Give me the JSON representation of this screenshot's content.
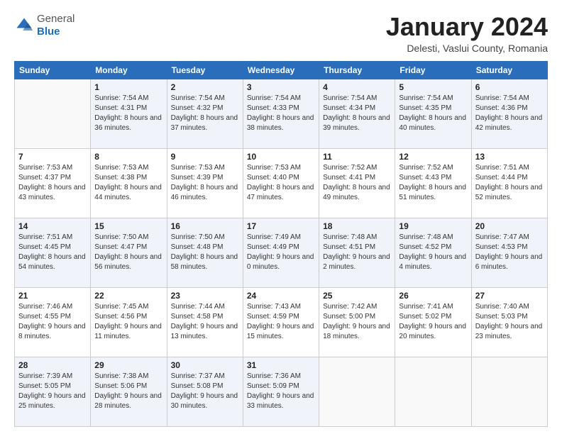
{
  "header": {
    "logo": {
      "general": "General",
      "blue": "Blue"
    },
    "title": "January 2024",
    "location": "Delesti, Vaslui County, Romania"
  },
  "days_of_week": [
    "Sunday",
    "Monday",
    "Tuesday",
    "Wednesday",
    "Thursday",
    "Friday",
    "Saturday"
  ],
  "weeks": [
    [
      {
        "day": "",
        "sunrise": "",
        "sunset": "",
        "daylight": ""
      },
      {
        "day": "1",
        "sunrise": "Sunrise: 7:54 AM",
        "sunset": "Sunset: 4:31 PM",
        "daylight": "Daylight: 8 hours and 36 minutes."
      },
      {
        "day": "2",
        "sunrise": "Sunrise: 7:54 AM",
        "sunset": "Sunset: 4:32 PM",
        "daylight": "Daylight: 8 hours and 37 minutes."
      },
      {
        "day": "3",
        "sunrise": "Sunrise: 7:54 AM",
        "sunset": "Sunset: 4:33 PM",
        "daylight": "Daylight: 8 hours and 38 minutes."
      },
      {
        "day": "4",
        "sunrise": "Sunrise: 7:54 AM",
        "sunset": "Sunset: 4:34 PM",
        "daylight": "Daylight: 8 hours and 39 minutes."
      },
      {
        "day": "5",
        "sunrise": "Sunrise: 7:54 AM",
        "sunset": "Sunset: 4:35 PM",
        "daylight": "Daylight: 8 hours and 40 minutes."
      },
      {
        "day": "6",
        "sunrise": "Sunrise: 7:54 AM",
        "sunset": "Sunset: 4:36 PM",
        "daylight": "Daylight: 8 hours and 42 minutes."
      }
    ],
    [
      {
        "day": "7",
        "sunrise": "Sunrise: 7:53 AM",
        "sunset": "Sunset: 4:37 PM",
        "daylight": "Daylight: 8 hours and 43 minutes."
      },
      {
        "day": "8",
        "sunrise": "Sunrise: 7:53 AM",
        "sunset": "Sunset: 4:38 PM",
        "daylight": "Daylight: 8 hours and 44 minutes."
      },
      {
        "day": "9",
        "sunrise": "Sunrise: 7:53 AM",
        "sunset": "Sunset: 4:39 PM",
        "daylight": "Daylight: 8 hours and 46 minutes."
      },
      {
        "day": "10",
        "sunrise": "Sunrise: 7:53 AM",
        "sunset": "Sunset: 4:40 PM",
        "daylight": "Daylight: 8 hours and 47 minutes."
      },
      {
        "day": "11",
        "sunrise": "Sunrise: 7:52 AM",
        "sunset": "Sunset: 4:41 PM",
        "daylight": "Daylight: 8 hours and 49 minutes."
      },
      {
        "day": "12",
        "sunrise": "Sunrise: 7:52 AM",
        "sunset": "Sunset: 4:43 PM",
        "daylight": "Daylight: 8 hours and 51 minutes."
      },
      {
        "day": "13",
        "sunrise": "Sunrise: 7:51 AM",
        "sunset": "Sunset: 4:44 PM",
        "daylight": "Daylight: 8 hours and 52 minutes."
      }
    ],
    [
      {
        "day": "14",
        "sunrise": "Sunrise: 7:51 AM",
        "sunset": "Sunset: 4:45 PM",
        "daylight": "Daylight: 8 hours and 54 minutes."
      },
      {
        "day": "15",
        "sunrise": "Sunrise: 7:50 AM",
        "sunset": "Sunset: 4:47 PM",
        "daylight": "Daylight: 8 hours and 56 minutes."
      },
      {
        "day": "16",
        "sunrise": "Sunrise: 7:50 AM",
        "sunset": "Sunset: 4:48 PM",
        "daylight": "Daylight: 8 hours and 58 minutes."
      },
      {
        "day": "17",
        "sunrise": "Sunrise: 7:49 AM",
        "sunset": "Sunset: 4:49 PM",
        "daylight": "Daylight: 9 hours and 0 minutes."
      },
      {
        "day": "18",
        "sunrise": "Sunrise: 7:48 AM",
        "sunset": "Sunset: 4:51 PM",
        "daylight": "Daylight: 9 hours and 2 minutes."
      },
      {
        "day": "19",
        "sunrise": "Sunrise: 7:48 AM",
        "sunset": "Sunset: 4:52 PM",
        "daylight": "Daylight: 9 hours and 4 minutes."
      },
      {
        "day": "20",
        "sunrise": "Sunrise: 7:47 AM",
        "sunset": "Sunset: 4:53 PM",
        "daylight": "Daylight: 9 hours and 6 minutes."
      }
    ],
    [
      {
        "day": "21",
        "sunrise": "Sunrise: 7:46 AM",
        "sunset": "Sunset: 4:55 PM",
        "daylight": "Daylight: 9 hours and 8 minutes."
      },
      {
        "day": "22",
        "sunrise": "Sunrise: 7:45 AM",
        "sunset": "Sunset: 4:56 PM",
        "daylight": "Daylight: 9 hours and 11 minutes."
      },
      {
        "day": "23",
        "sunrise": "Sunrise: 7:44 AM",
        "sunset": "Sunset: 4:58 PM",
        "daylight": "Daylight: 9 hours and 13 minutes."
      },
      {
        "day": "24",
        "sunrise": "Sunrise: 7:43 AM",
        "sunset": "Sunset: 4:59 PM",
        "daylight": "Daylight: 9 hours and 15 minutes."
      },
      {
        "day": "25",
        "sunrise": "Sunrise: 7:42 AM",
        "sunset": "Sunset: 5:00 PM",
        "daylight": "Daylight: 9 hours and 18 minutes."
      },
      {
        "day": "26",
        "sunrise": "Sunrise: 7:41 AM",
        "sunset": "Sunset: 5:02 PM",
        "daylight": "Daylight: 9 hours and 20 minutes."
      },
      {
        "day": "27",
        "sunrise": "Sunrise: 7:40 AM",
        "sunset": "Sunset: 5:03 PM",
        "daylight": "Daylight: 9 hours and 23 minutes."
      }
    ],
    [
      {
        "day": "28",
        "sunrise": "Sunrise: 7:39 AM",
        "sunset": "Sunset: 5:05 PM",
        "daylight": "Daylight: 9 hours and 25 minutes."
      },
      {
        "day": "29",
        "sunrise": "Sunrise: 7:38 AM",
        "sunset": "Sunset: 5:06 PM",
        "daylight": "Daylight: 9 hours and 28 minutes."
      },
      {
        "day": "30",
        "sunrise": "Sunrise: 7:37 AM",
        "sunset": "Sunset: 5:08 PM",
        "daylight": "Daylight: 9 hours and 30 minutes."
      },
      {
        "day": "31",
        "sunrise": "Sunrise: 7:36 AM",
        "sunset": "Sunset: 5:09 PM",
        "daylight": "Daylight: 9 hours and 33 minutes."
      },
      {
        "day": "",
        "sunrise": "",
        "sunset": "",
        "daylight": ""
      },
      {
        "day": "",
        "sunrise": "",
        "sunset": "",
        "daylight": ""
      },
      {
        "day": "",
        "sunrise": "",
        "sunset": "",
        "daylight": ""
      }
    ]
  ]
}
